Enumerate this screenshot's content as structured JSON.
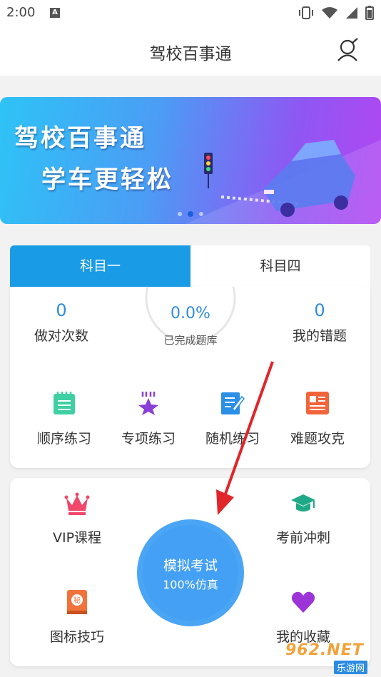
{
  "status": {
    "time": "2:00",
    "notification_icon_text": "A"
  },
  "header": {
    "title": "驾校百事通"
  },
  "banner": {
    "line1": "驾校百事通",
    "line2": "学车更轻松",
    "slide_count": 3,
    "active_slide": 2
  },
  "tabs": [
    {
      "label": "科目一",
      "active": true
    },
    {
      "label": "科目四",
      "active": false
    }
  ],
  "stats": {
    "correct_count": {
      "value": "0",
      "label": "做对次数"
    },
    "completion": {
      "value": "0.0%",
      "label": "已完成题库",
      "fraction": 0.0
    },
    "wrong_count": {
      "value": "0",
      "label": "我的错题"
    }
  },
  "practice": [
    {
      "label": "顺序练习",
      "icon": "notepad-icon",
      "color": "#3ed0a3"
    },
    {
      "label": "专项练习",
      "icon": "star-icon",
      "color": "#8a3fd6"
    },
    {
      "label": "随机练习",
      "icon": "edit-note-icon",
      "color": "#2b8fe6"
    },
    {
      "label": "难题攻克",
      "icon": "document-icon",
      "color": "#f2643a"
    }
  ],
  "features": {
    "vip": {
      "label": "VIP课程",
      "icon": "crown-icon",
      "color": "#f0476a"
    },
    "sprint": {
      "label": "考前冲刺",
      "icon": "graduation-cap-icon",
      "color": "#1fa987"
    },
    "tips": {
      "label": "图标技巧",
      "icon": "secret-book-icon",
      "color": "#f1733c"
    },
    "favorites": {
      "label": "我的收藏",
      "icon": "heart-icon",
      "color": "#9b35d8"
    }
  },
  "exam": {
    "title": "模拟考试",
    "subtitle": "100%仿真"
  },
  "watermark": {
    "top": "962.NET",
    "bottom": "乐游网"
  }
}
